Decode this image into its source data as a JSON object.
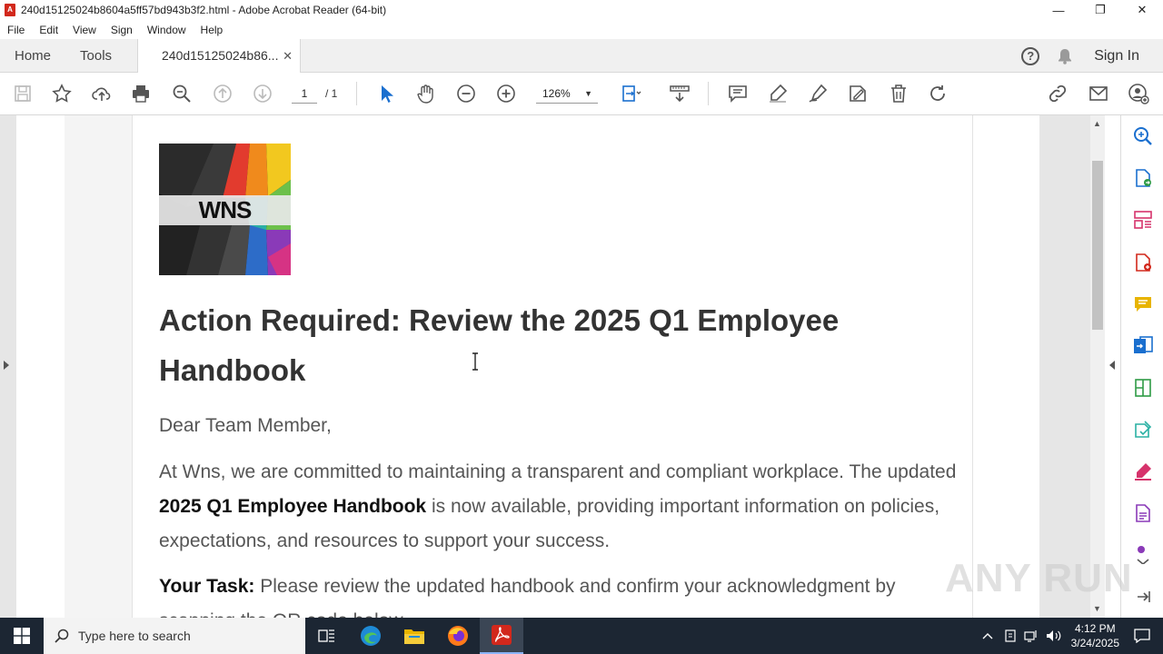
{
  "window": {
    "title": "240d15125024b8604a5ff57bd943b3f2.html - Adobe Acrobat Reader (64-bit)",
    "app_icon_letter": "A",
    "minimize": "—",
    "maximize": "❐",
    "close": "✕"
  },
  "menu": [
    "File",
    "Edit",
    "View",
    "Sign",
    "Window",
    "Help"
  ],
  "tabs": {
    "home": "Home",
    "tools": "Tools",
    "document": "240d15125024b86...",
    "close": "✕",
    "help": "?",
    "signin": "Sign In"
  },
  "toolbar": {
    "page_current": "1",
    "page_total": "/ 1",
    "zoom": "126%",
    "zoom_caret": "▼"
  },
  "email": {
    "logo_text": "WNS",
    "heading": "Action Required: Review the 2025 Q1 Employee Handbook",
    "greeting": "Dear Team Member,",
    "para1_a": "At Wns, we are committed to maintaining a transparent and compliant workplace. The updated ",
    "para1_bold": "2025 Q1 Employee Handbook",
    "para1_b": " is now available, providing important information on policies, expectations, and resources to support your success.",
    "task_label": "Your Task:",
    "task_text": " Please review the updated handbook and confirm your acknowledgment by scanning the QR code below."
  },
  "scrollbar": {
    "up": "▲",
    "down": "▼"
  },
  "watermark": "ANY RUN",
  "taskbar": {
    "search_placeholder": "Type here to search",
    "time": "4:12 PM",
    "date": "3/24/2025"
  },
  "colors": {
    "acrobat_red": "#d2281c",
    "icon_blue": "#1a6fcf",
    "icon_green": "#2e9b45",
    "icon_yellow": "#e8b400",
    "icon_pink": "#d6336c",
    "taskbar_bg": "#1c2633"
  }
}
